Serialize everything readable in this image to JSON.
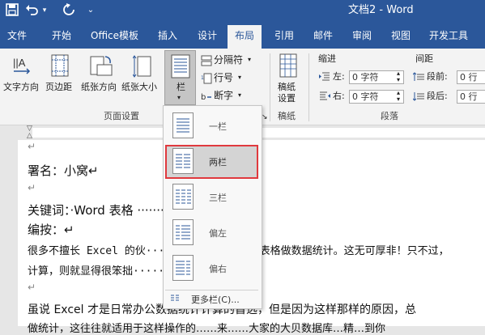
{
  "titlebar": {
    "title": "文档2 - Word",
    "icons": [
      "save-icon",
      "undo-icon",
      "undo-dropdown-icon",
      "redo-icon",
      "customize-qat-icon"
    ]
  },
  "tabs": [
    "文件",
    "开始",
    "Office模板",
    "插入",
    "设计",
    "布局",
    "引用",
    "邮件",
    "审阅",
    "视图",
    "开发工具"
  ],
  "active_tab": "布局",
  "ribbon": {
    "page_setup": {
      "text_direction": "文字方向",
      "margins": "页边距",
      "orientation": "纸张方向",
      "size": "纸张大小",
      "columns": "栏",
      "breaks": "分隔符",
      "line_numbers": "行号",
      "hyphenation": "断字",
      "group_label": "页面设置"
    },
    "manuscript": {
      "label_line1": "稿纸",
      "label_line2": "设置",
      "group_label": "稿纸"
    },
    "paragraph": {
      "indent_title": "缩进",
      "spacing_title": "间距",
      "left_label": "左:",
      "left_value": "0 字符",
      "right_label": "右:",
      "right_value": "0 字符",
      "before_label": "段前:",
      "before_value": "0 行",
      "after_label": "段后:",
      "after_value": "0 行",
      "group_label": "段落"
    }
  },
  "columns_menu": {
    "items": [
      "一栏",
      "两栏",
      "三栏",
      "偏左",
      "偏右"
    ],
    "highlighted": "两栏",
    "more": "更多栏(C)..."
  },
  "document": {
    "lines": [
      {
        "text": "↵"
      },
      {
        "text": "署名：小窝↵"
      },
      {
        "text": "↵"
      },
      {
        "text": "关键词：·Word 表格 ·······↵"
      },
      {
        "text": "编按：↵"
      },
      {
        "text": "很多不擅长 Excel 的伙··················表格做数据统计。这无可厚非！只不过，"
      },
      {
        "text": "计算，则就显得很笨拙······"
      },
      {
        "text": "↵"
      },
      {
        "text": "虽说 Excel 才是日常办公数据统计计算的首选，但是因为这样那样的原因，总"
      },
      {
        "text": "做统计，这往往就适用于这样操作的……来……大家的大贝数据库…精…到你"
      }
    ]
  }
}
